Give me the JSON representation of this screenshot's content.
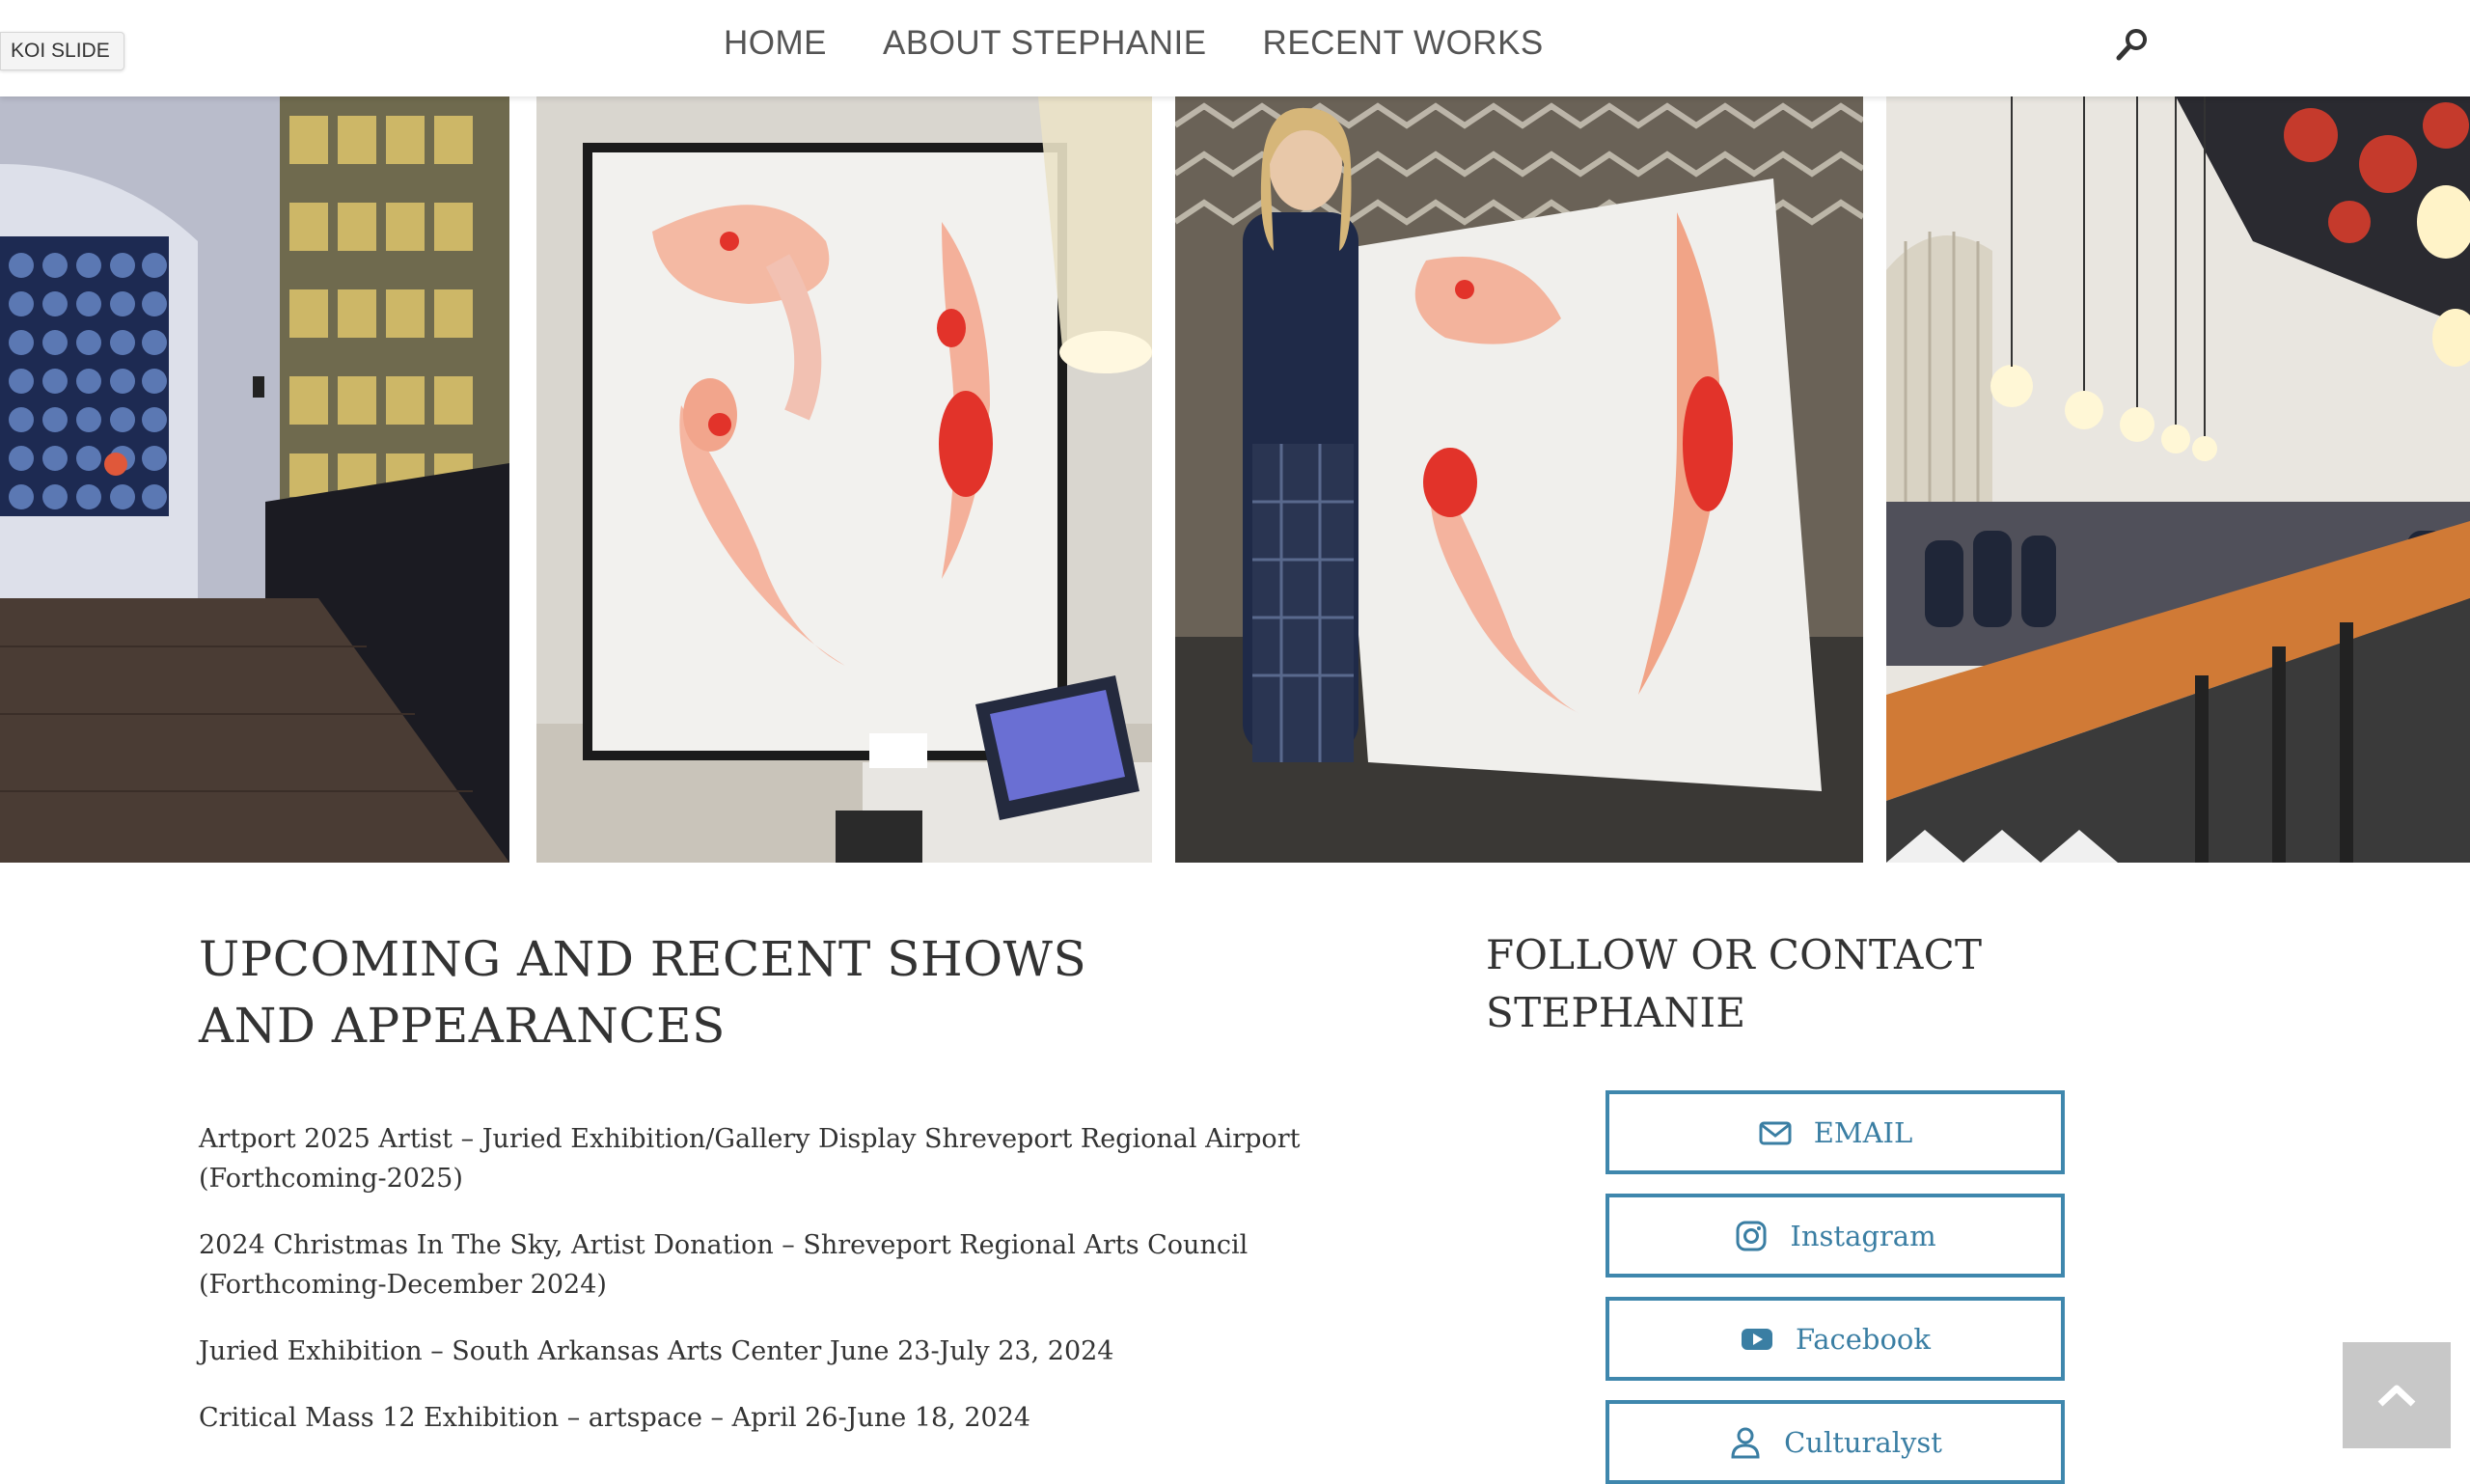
{
  "slide_tag": "KOI SLIDE",
  "nav": {
    "items": [
      "HOME",
      "ABOUT STEPHANIE",
      "RECENT WORKS"
    ]
  },
  "icons": {
    "search": "search-icon",
    "email": "envelope-icon",
    "instagram": "instagram-icon",
    "facebook": "play-icon",
    "culturalyst": "person-icon",
    "top": "chevron-up-icon"
  },
  "shows": {
    "title": "UPCOMING AND RECENT SHOWS AND APPEARANCES",
    "items": [
      "Artport 2025 Artist – Juried Exhibition/Gallery Display Shreveport Regional Airport (Forthcoming-2025)",
      "2024 Christmas In The Sky, Artist Donation – Shreveport Regional Arts Council (Forthcoming-December 2024)",
      "Juried Exhibition – South Arkansas Arts Center June 23-July 23, 2024",
      "Critical Mass 12 Exhibition – artspace – April 26-June 18, 2024"
    ]
  },
  "follow": {
    "title": "FOLLOW OR CONTACT STEPHANIE",
    "buttons": [
      "EMAIL",
      "Instagram",
      "Facebook",
      "Culturalyst"
    ]
  },
  "colors": {
    "accent": "#3f87ad",
    "button_text": "#3a7ea3",
    "koi_red": "#e2332a"
  }
}
